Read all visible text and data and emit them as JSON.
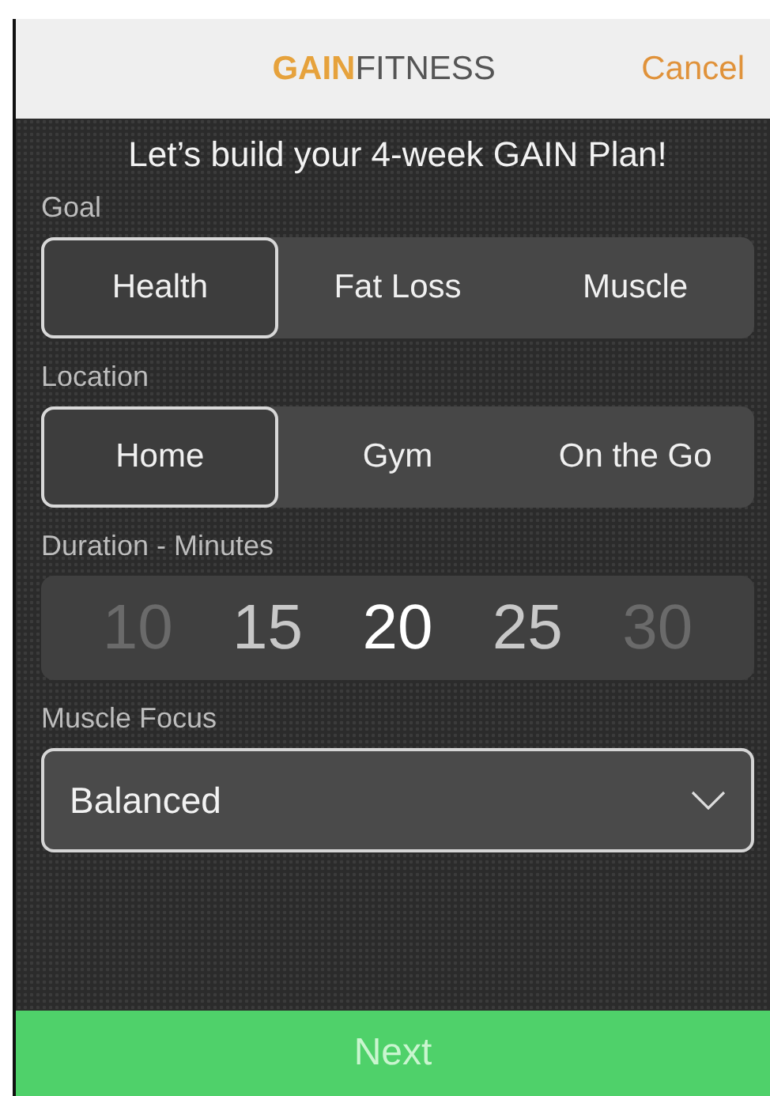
{
  "header": {
    "logo_part_1": "GAIN",
    "logo_part_2": "FITNESS",
    "cancel": "Cancel"
  },
  "heading": "Let’s build your 4-week GAIN Plan!",
  "goal": {
    "label": "Goal",
    "options": [
      {
        "label": "Health",
        "selected": true
      },
      {
        "label": "Fat Loss",
        "selected": false
      },
      {
        "label": "Muscle",
        "selected": false
      }
    ]
  },
  "location": {
    "label": "Location",
    "options": [
      {
        "label": "Home",
        "selected": true
      },
      {
        "label": "Gym",
        "selected": false
      },
      {
        "label": "On the Go",
        "selected": false
      }
    ]
  },
  "duration": {
    "label": "Duration - Minutes",
    "values": [
      {
        "label": "10",
        "selected": false
      },
      {
        "label": "15",
        "selected": false
      },
      {
        "label": "20",
        "selected": true
      },
      {
        "label": "25",
        "selected": false
      },
      {
        "label": "30",
        "selected": false
      }
    ]
  },
  "muscle_focus": {
    "label": "Muscle Focus",
    "value": "Balanced"
  },
  "next_button": "Next"
}
